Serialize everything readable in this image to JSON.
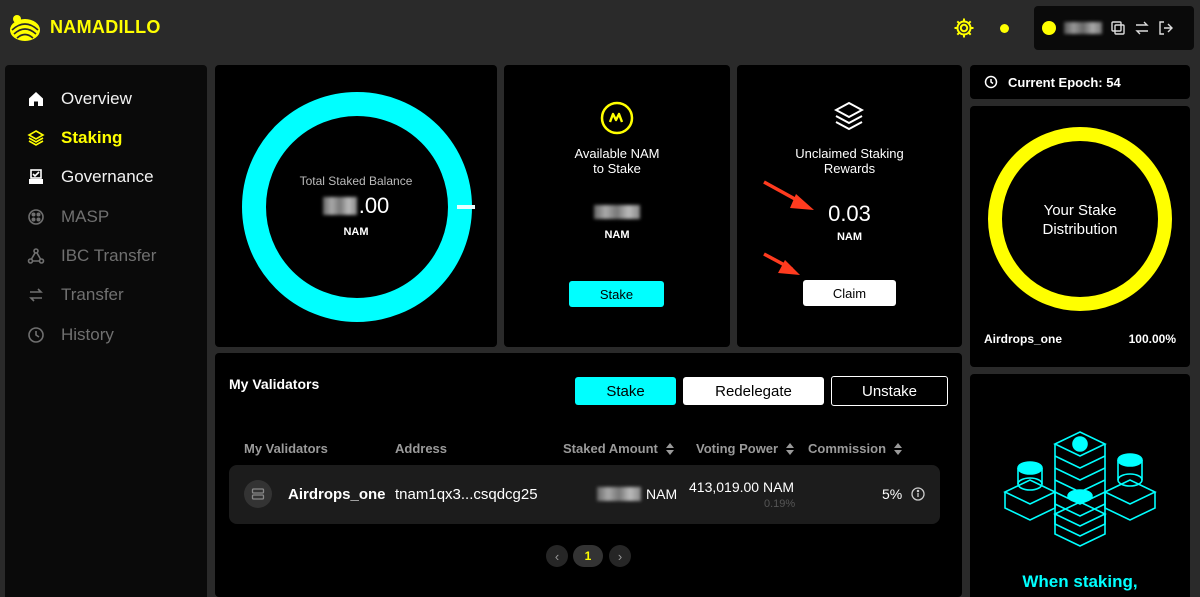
{
  "app": {
    "name": "NAMADILLO"
  },
  "header": {
    "account_name": "••••••"
  },
  "sidebar": {
    "items": [
      {
        "label": "Overview",
        "icon": "home-icon"
      },
      {
        "label": "Staking",
        "icon": "layers-icon"
      },
      {
        "label": "Governance",
        "icon": "ballot-box-icon"
      },
      {
        "label": "MASP",
        "icon": "masp-icon"
      },
      {
        "label": "IBC Transfer",
        "icon": "ibc-icon"
      },
      {
        "label": "Transfer",
        "icon": "transfer-arrows-icon"
      },
      {
        "label": "History",
        "icon": "history-icon"
      }
    ]
  },
  "total": {
    "label": "Total Staked Balance",
    "value_suffix": ".00",
    "unit": "NAM"
  },
  "available": {
    "title_line1": "Available NAM",
    "title_line2": "to Stake",
    "unit": "NAM",
    "button": "Stake"
  },
  "unclaimed": {
    "title_line1": "Unclaimed Staking",
    "title_line2": "Rewards",
    "value": "0.03",
    "unit": "NAM",
    "button": "Claim"
  },
  "epoch": {
    "label": "Current Epoch: 54"
  },
  "distribution": {
    "title_line1": "Your Stake",
    "title_line2": "Distribution",
    "validator": "Airdrops_one",
    "percent": "100.00%"
  },
  "validators": {
    "title": "My Validators",
    "buttons": {
      "stake": "Stake",
      "redelegate": "Redelegate",
      "unstake": "Unstake"
    },
    "columns": [
      "My Validators",
      "Address",
      "Staked Amount",
      "Voting Power",
      "Commission"
    ],
    "rows": [
      {
        "name": "Airdrops_one",
        "address": "tnam1qx3...csqdcg25",
        "staked_unit": "NAM",
        "voting_power": "413,019.00 NAM",
        "voting_power_pct": "0.19%",
        "commission": "5%"
      }
    ],
    "page": "1"
  },
  "promo": {
    "text": "When staking,"
  },
  "colors": {
    "accent": "#ffff00",
    "cyan": "#00ffff",
    "bg": "#2a2a2a",
    "card": "#000000"
  }
}
